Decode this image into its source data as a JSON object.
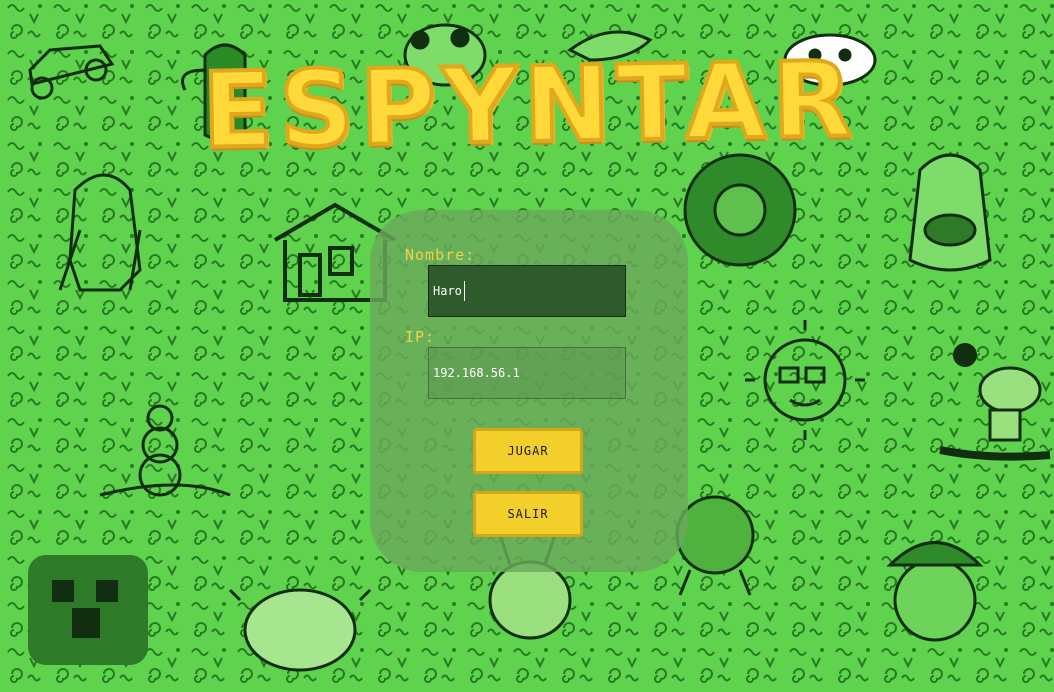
{
  "game": {
    "title": "ESPYNTAR"
  },
  "form": {
    "name_label": "Nombre:",
    "name_value": "Haro",
    "ip_label": "IP:",
    "ip_value": "192.168.56.1"
  },
  "buttons": {
    "play_label": "JUGAR",
    "exit_label": "SALIR"
  },
  "colors": {
    "background": "#5fd24e",
    "doodle_ink": "#1a5a14",
    "accent_yellow": "#f3cf2b",
    "label_gold": "#f2cf4d",
    "panel": "#6aaa5c"
  }
}
